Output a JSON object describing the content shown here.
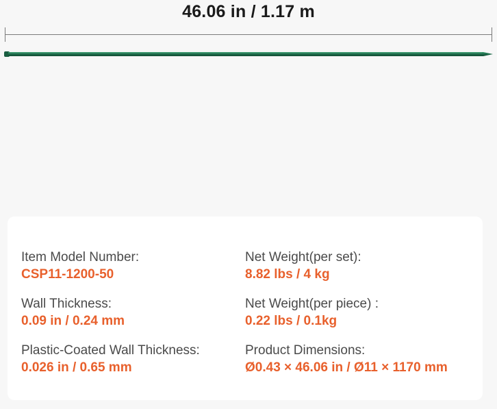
{
  "header": {
    "dimension_text": "46.06 in / 1.17 m"
  },
  "colors": {
    "accent": "#e8602c",
    "stake_green": "#1f6e4c",
    "label_gray": "#4a4a4a",
    "background": "#f7f7f7",
    "card": "#ffffff"
  },
  "specs": {
    "left": [
      {
        "label": "Item Model Number:",
        "value": "CSP11-1200-50"
      },
      {
        "label": "Wall Thickness:",
        "value": "0.09 in / 0.24 mm"
      },
      {
        "label": "Plastic-Coated Wall Thickness:",
        "value": "0.026 in / 0.65 mm"
      }
    ],
    "right": [
      {
        "label": "Net Weight(per set):",
        "value": "8.82 lbs / 4 kg"
      },
      {
        "label": "Net Weight(per piece) :",
        "value": "0.22 lbs / 0.1kg"
      },
      {
        "label": "Product Dimensions:",
        "value": "Ø0.43 × 46.06 in / Ø11 × 1170 mm"
      }
    ]
  }
}
